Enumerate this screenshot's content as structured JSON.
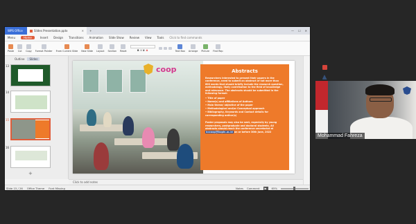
{
  "app": {
    "app_tab": "WPS Office",
    "doc_tab": "Slides Presentation.pptx"
  },
  "menu": {
    "items": [
      "Menu",
      "Home",
      "Insert",
      "Design",
      "Transitions",
      "Animation",
      "Slide Show",
      "Review",
      "View",
      "Tools"
    ],
    "active": "Home",
    "search": "Click to find commands"
  },
  "ribbon": {
    "cut": "Cut",
    "copy": "Copy",
    "paste": "Paste",
    "format_painter": "Format Painter",
    "from_current": "From Current Slide",
    "new_slide": "New Slide",
    "layout": "Layout",
    "section": "Section",
    "reset": "Reset",
    "font_placeholder": "",
    "text_box": "Text Box",
    "arrange": "Arrange",
    "picture": "Picture",
    "find_replace": "Find Rep"
  },
  "left_panel": {
    "tab_outline": "Outline",
    "tab_slides": "Slides",
    "slide_numbers": [
      "13",
      "14",
      "15",
      "16"
    ],
    "add": "+"
  },
  "slide": {
    "logo_text": "coop",
    "box_title": "Abstracts",
    "box_intro": "Researchers interested to present their papers in the conference, need to submit an abstract of not more than 600 words that should briefly include the research question, methodology, likely contribution to the field of knowledge and relevance. The abstracts should be submitted in the following format:",
    "bullets": [
      "• Title of paper",
      "• Name(s) and affiliations of Authors",
      "• Main theme/ objective of the paper",
      "• Methodological and/or Conceptual approach",
      "• Bibliography, Keywords and Contact details for corresponding author(s)"
    ],
    "box_outro_1": "Poster proposals may also be sent, especially by young researchers, postgraduate and doctoral students. All abstracts should reach the conference secretariat at",
    "email": "icccoop@ikopin.ac.id",
    "box_outro_2": "on or before 30th June, 2022"
  },
  "notes": "Click to add notes",
  "status": {
    "slide_pos": "Slide 15 / 26",
    "theme": "Office Theme",
    "font_missing": "Font Missing",
    "notes_btn": "Notes",
    "comment_btn": "Comment",
    "zoom": "65%"
  },
  "webcam": {
    "name": "Mohammad Fahreza"
  },
  "colors": {
    "accent": "#e05d3a",
    "slide_box": "#ee7a2a",
    "wps_blue": "#3a6fd8"
  }
}
